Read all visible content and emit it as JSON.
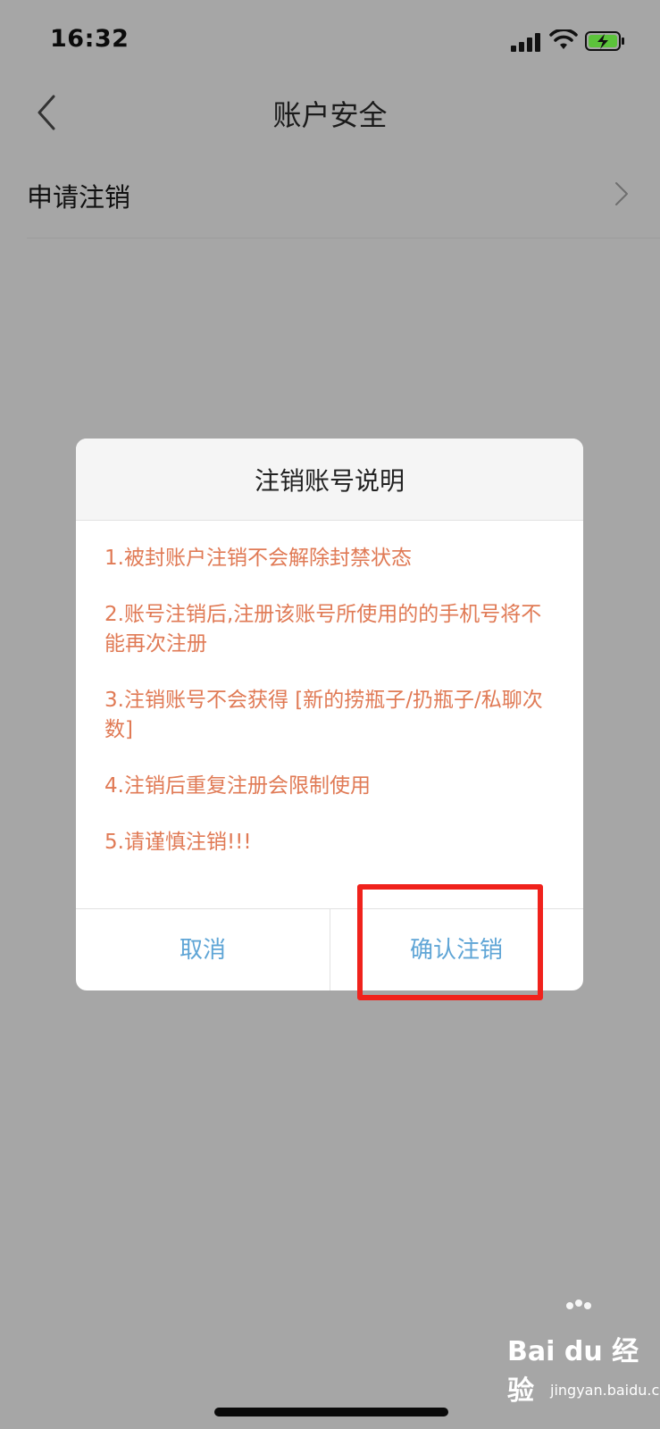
{
  "status_bar": {
    "time": "16:32"
  },
  "nav": {
    "title": "账户安全"
  },
  "list": {
    "items": [
      {
        "label": "申请注销"
      }
    ]
  },
  "dialog": {
    "title": "注销账号说明",
    "notices": [
      "1.被封账户注销不会解除封禁状态",
      "2.账号注销后,注册该账号所使用的的手机号将不能再次注册",
      "3.注销账号不会获得 [新的捞瓶子/扔瓶子/私聊次数]",
      "4.注销后重复注册会限制使用",
      "5.请谨慎注销!!!"
    ],
    "cancel_label": "取消",
    "confirm_label": "确认注销"
  },
  "watermark": {
    "brand": "Bai du 经验",
    "url": "jingyan.baidu.com"
  },
  "colors": {
    "notice_text": "#e07a55",
    "button_text": "#5fa5d6",
    "highlight": "#f0221c",
    "overlay": "#a6a6a6"
  }
}
